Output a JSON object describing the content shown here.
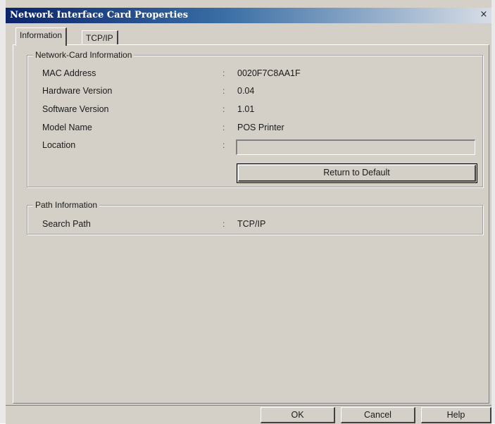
{
  "window": {
    "title": "Network Interface Card Properties",
    "close_glyph": "×"
  },
  "tabs": [
    {
      "label": "Information",
      "active": true
    },
    {
      "label": "TCP/IP",
      "active": false
    }
  ],
  "network_card_group": {
    "legend": "Network-Card Information",
    "rows": [
      {
        "label": "MAC Address",
        "colon": ":",
        "value": "0020F7C8AA1F"
      },
      {
        "label": "Hardware Version",
        "colon": ":",
        "value": "0.04"
      },
      {
        "label": "Software Version",
        "colon": ":",
        "value": "1.01"
      },
      {
        "label": "Model Name",
        "colon": ":",
        "value": "POS Printer"
      },
      {
        "label": "Location",
        "colon": ":",
        "value": ""
      }
    ],
    "return_default_label": "Return to Default"
  },
  "path_group": {
    "legend": "Path Information",
    "rows": [
      {
        "label": "Search Path",
        "colon": ":",
        "value": "TCP/IP"
      }
    ]
  },
  "buttons": {
    "ok": "OK",
    "cancel": "Cancel",
    "help": "Help"
  },
  "icons": {
    "close": "close-icon"
  }
}
